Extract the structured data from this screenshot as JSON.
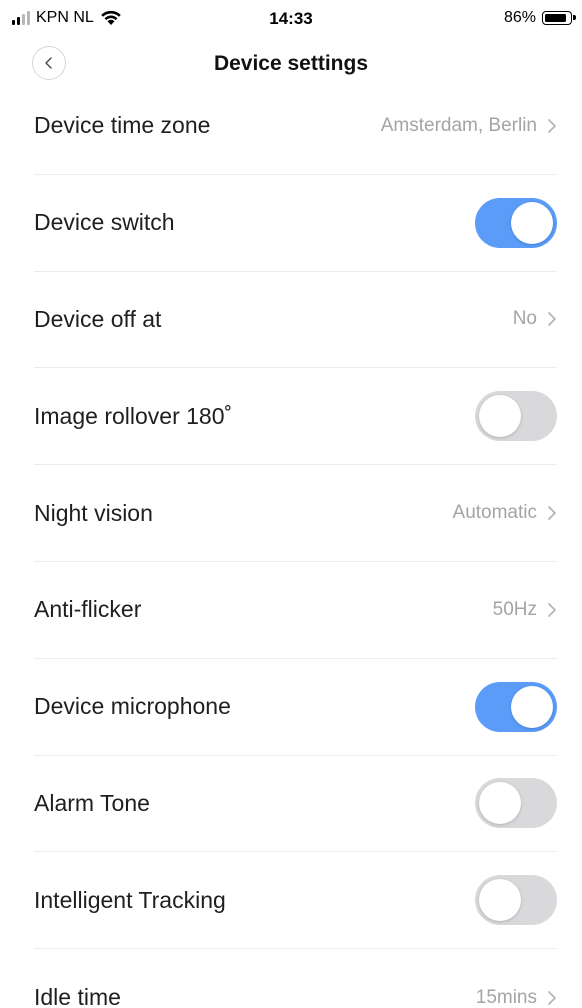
{
  "status_bar": {
    "carrier": "KPN NL",
    "time": "14:33",
    "battery": "86%",
    "battery_level": 0.86
  },
  "header": {
    "title": "Device settings",
    "back_icon": "chevron-left-icon"
  },
  "settings": [
    {
      "label": "Device time zone",
      "type": "link",
      "value": "Amsterdam, Berlin"
    },
    {
      "label": "Device switch",
      "type": "toggle",
      "on": true
    },
    {
      "label": "Device off at",
      "type": "link",
      "value": "No"
    },
    {
      "label": "Image rollover 180˚",
      "type": "toggle",
      "on": false
    },
    {
      "label": "Night vision",
      "type": "link",
      "value": "Automatic"
    },
    {
      "label": "Anti-flicker",
      "type": "link",
      "value": "50Hz"
    },
    {
      "label": "Device microphone",
      "type": "toggle",
      "on": true
    },
    {
      "label": "Alarm Tone",
      "type": "toggle",
      "on": false
    },
    {
      "label": "Intelligent Tracking",
      "type": "toggle",
      "on": false
    },
    {
      "label": "Idle time",
      "type": "link",
      "value": "15mins"
    }
  ],
  "colors": {
    "toggle_on": "#5a9cf8",
    "toggle_off": "#d9d9dc",
    "value_text": "#a4a4a4"
  }
}
